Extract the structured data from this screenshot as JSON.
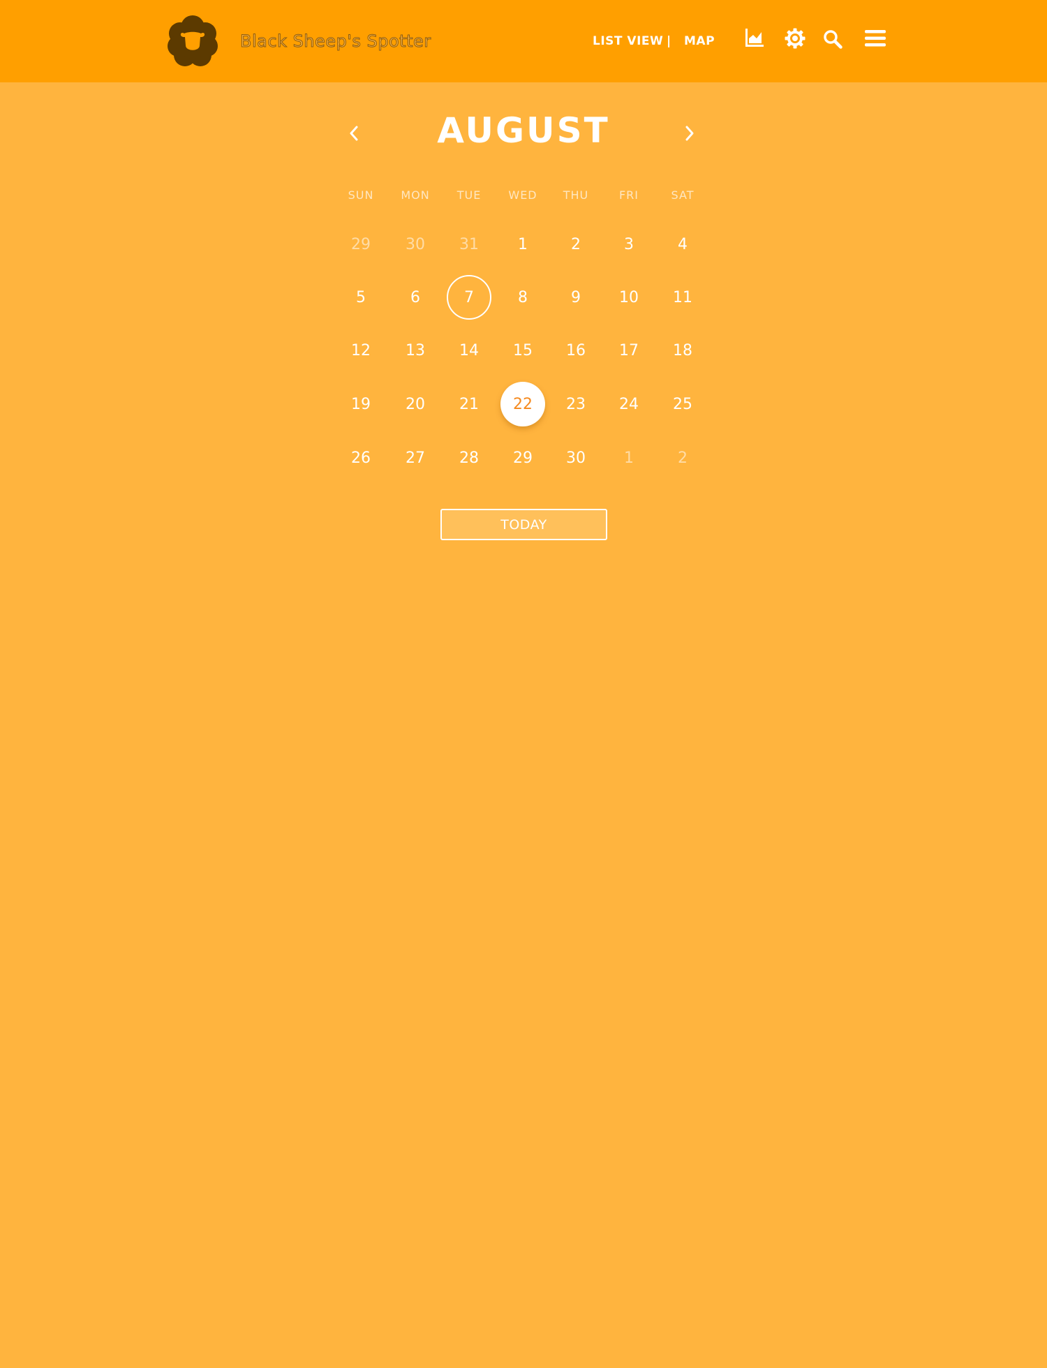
{
  "header": {
    "brand_name": "Black Sheep's Spotter",
    "nav": {
      "list_view": "LIST VIEW",
      "separator": "|",
      "map": "MAP"
    },
    "icons": [
      "chart-icon",
      "gear-icon",
      "search-icon",
      "menu-icon"
    ],
    "colors": {
      "bar": "#FF9F00",
      "logo": "#5C3A00"
    }
  },
  "calendar": {
    "month": "AUGUST",
    "prev_icon": "chevron-left-icon",
    "next_icon": "chevron-right-icon",
    "weekdays": [
      "SUN",
      "MON",
      "TUE",
      "WED",
      "THU",
      "FRI",
      "SAT"
    ],
    "weeks": [
      [
        {
          "d": "29",
          "muted": true
        },
        {
          "d": "30",
          "muted": true
        },
        {
          "d": "31",
          "muted": true
        },
        {
          "d": "1"
        },
        {
          "d": "2"
        },
        {
          "d": "3"
        },
        {
          "d": "4"
        }
      ],
      [
        {
          "d": "5"
        },
        {
          "d": "6"
        },
        {
          "d": "7",
          "outlined": true
        },
        {
          "d": "8"
        },
        {
          "d": "9"
        },
        {
          "d": "10"
        },
        {
          "d": "11"
        }
      ],
      [
        {
          "d": "12"
        },
        {
          "d": "13"
        },
        {
          "d": "14"
        },
        {
          "d": "15"
        },
        {
          "d": "16"
        },
        {
          "d": "17"
        },
        {
          "d": "18"
        }
      ],
      [
        {
          "d": "19"
        },
        {
          "d": "20"
        },
        {
          "d": "21"
        },
        {
          "d": "22",
          "today": true
        },
        {
          "d": "23"
        },
        {
          "d": "24"
        },
        {
          "d": "25"
        }
      ],
      [
        {
          "d": "26"
        },
        {
          "d": "27"
        },
        {
          "d": "28"
        },
        {
          "d": "29"
        },
        {
          "d": "30"
        },
        {
          "d": "1",
          "muted": true
        },
        {
          "d": "2",
          "muted": true
        }
      ]
    ],
    "today_label": "TODAY",
    "colors": {
      "background": "#FFB43E",
      "today_text": "#F58A1F"
    }
  }
}
